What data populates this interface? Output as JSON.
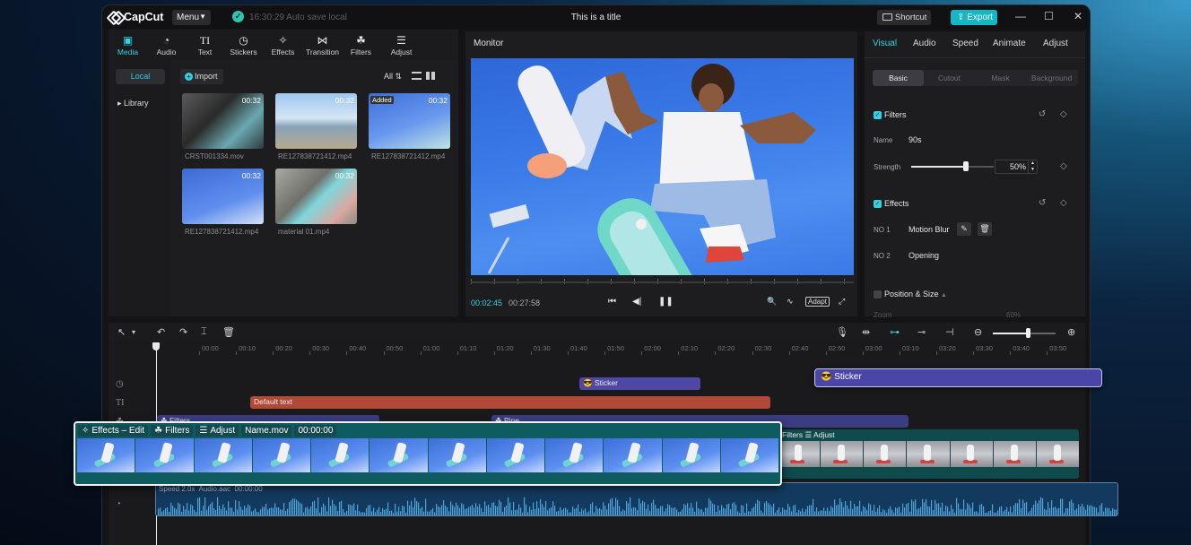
{
  "app": {
    "logo": "CapCut",
    "menu_label": "Menu",
    "autosave": "16:30:29 Auto save local",
    "title": "This is a title",
    "shortcut_label": "Shortcut",
    "export_label": "Export"
  },
  "toolbar": {
    "items": [
      {
        "label": "Media",
        "icon": "media-icon"
      },
      {
        "label": "Audio",
        "icon": "audio-icon"
      },
      {
        "label": "Text",
        "icon": "text-icon"
      },
      {
        "label": "Stickers",
        "icon": "stickers-icon"
      },
      {
        "label": "Effects",
        "icon": "effects-icon"
      },
      {
        "label": "Transition",
        "icon": "transition-icon"
      },
      {
        "label": "Filters",
        "icon": "filters-icon"
      },
      {
        "label": "Adjust",
        "icon": "adjust-icon"
      }
    ]
  },
  "media": {
    "sidebar": {
      "local": "Local",
      "library": "Library"
    },
    "import_label": "Import",
    "filter_label": "All",
    "clips": [
      {
        "name": "CRST001334.mov",
        "duration": "00:32",
        "added": ""
      },
      {
        "name": "RE127838721412.mp4",
        "duration": "00:32",
        "added": ""
      },
      {
        "name": "RE127838721412.mp4",
        "duration": "00:32",
        "added": "Added"
      },
      {
        "name": "RE127838721412.mp4",
        "duration": "00:32",
        "added": ""
      },
      {
        "name": "material 01.mp4",
        "duration": "00:32",
        "added": ""
      }
    ]
  },
  "monitor": {
    "title": "Monitor",
    "current_time": "00:02:45",
    "total_time": "00:27:58",
    "adapt_label": "Adapt"
  },
  "properties": {
    "tabs": [
      "Visual",
      "Audio",
      "Speed",
      "Animate",
      "Adjust"
    ],
    "subtabs": [
      "Basic",
      "Cutout",
      "Mask",
      "Background"
    ],
    "filters": {
      "title": "Filters",
      "name_label": "Name",
      "name_value": "90s",
      "strength_label": "Strength",
      "strength_value": "50%",
      "strength": 0.5
    },
    "effects": {
      "title": "Effects",
      "items": [
        {
          "no": "NO 1",
          "name": "Motion Blur"
        },
        {
          "no": "NO 2",
          "name": "Opening"
        }
      ]
    },
    "position_size": {
      "title": "Position & Size",
      "zoom_label": "Zoom",
      "zoom_value": "60%"
    }
  },
  "timeline": {
    "ruler": [
      "00:00",
      "00:10",
      "00:20",
      "00:30",
      "00:40",
      "00:50",
      "01:00",
      "01:10",
      "01:20",
      "01:30",
      "01:40",
      "01:50",
      "02:00",
      "02:10",
      "02:20",
      "02:30",
      "02:40",
      "02:50",
      "03:00",
      "03:10",
      "03:20",
      "03:30",
      "03:40",
      "03:50"
    ],
    "sticker_clip": "Sticker",
    "floating_sticker": "Sticker",
    "text_clip": "Default text",
    "filter_clip_1": "Filters",
    "filter_clip_2": "Pine",
    "main_tags": [
      "Effects – Edit",
      "Filters",
      "Adjust",
      "Name.mov",
      "00:00:00"
    ],
    "main_right_tags": [
      "Filters",
      "Adjust"
    ],
    "audio_tags": [
      "Speed 2.0x",
      "Audio.aac",
      "00:00:00"
    ]
  }
}
